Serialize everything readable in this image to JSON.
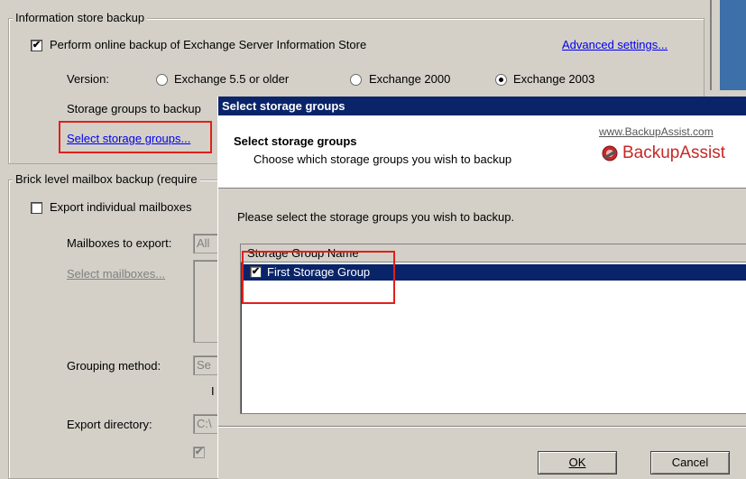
{
  "info_store": {
    "group_title": "Information store backup",
    "perform_online_label": "Perform online backup of Exchange Server Information Store",
    "perform_online_checked": true,
    "advanced_link": "Advanced settings...",
    "version_label": "Version:",
    "version_options": [
      "Exchange 5.5 or older",
      "Exchange 2000",
      "Exchange 2003"
    ],
    "version_selected": "Exchange 2003",
    "storage_groups_label": "Storage groups to backup",
    "select_groups_link": "Select storage groups..."
  },
  "brick": {
    "group_title": "Brick level mailbox backup (require",
    "export_individual_label": "Export individual mailboxes",
    "mailboxes_to_export_label": "Mailboxes to export:",
    "mailboxes_to_export_value": "All",
    "select_mailboxes_link": "Select mailboxes...",
    "grouping_method_label": "Grouping method:",
    "grouping_method_value": "Se",
    "grouping_extra": "I",
    "export_directory_label": "Export directory:",
    "export_directory_value": "C:\\"
  },
  "dialog": {
    "title": "Select storage groups",
    "header_title": "Select storage groups",
    "header_subtitle": "Choose which storage groups you wish to backup",
    "brand_url": "www.BackupAssist.com",
    "brand_name": "BackupAssist",
    "instruction": "Please select the storage groups you wish to backup.",
    "column_header": "Storage Group Name",
    "groups": [
      {
        "name": "First Storage Group",
        "checked": true,
        "selected": true
      }
    ],
    "ok_label": "OK",
    "cancel_label": "Cancel"
  },
  "colors": {
    "dialog_title_bg": "#0a246a",
    "selection_bg": "#0a246a",
    "highlight_border": "#e0201b",
    "window_bg": "#d4d0c8"
  }
}
